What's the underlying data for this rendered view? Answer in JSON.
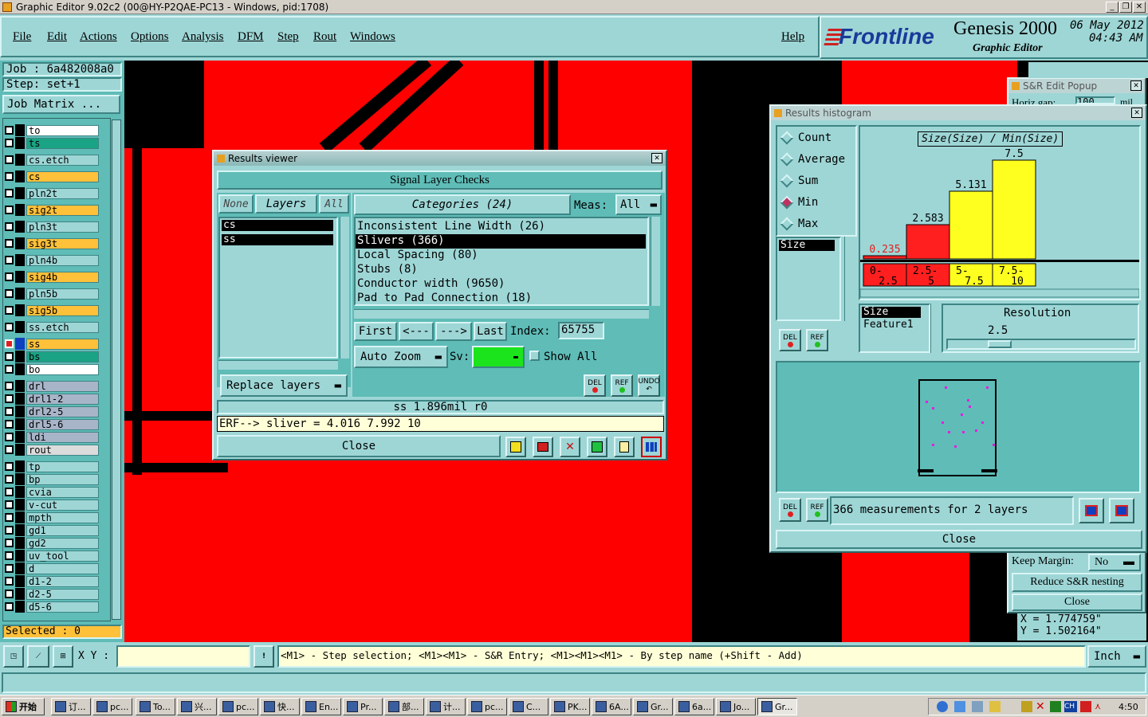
{
  "window_title": "Graphic Editor 9.02c2 (00@HY-P2QAE-PC13 - Windows, pid:1708)",
  "menu": {
    "file": "File",
    "edit": "Edit",
    "actions": "Actions",
    "options": "Options",
    "analysis": "Analysis",
    "dfm": "DFM",
    "step": "Step",
    "rout": "Rout",
    "windows": "Windows",
    "help": "Help"
  },
  "brand": {
    "logo": "Frontline",
    "product": "Genesis 2000",
    "subtitle": "Graphic Editor",
    "date": "06 May 2012",
    "time": "04:43 AM"
  },
  "left": {
    "job": "Job : 6a482008a0",
    "step": "Step: set+1",
    "job_matrix": "Job Matrix ...",
    "selected": "Selected : 0",
    "layers": [
      {
        "name": "to",
        "color": "#ffffff"
      },
      {
        "name": "ts",
        "color": "#1aa384"
      },
      {
        "name": "cs.etch",
        "color": "#9ed6d6"
      },
      {
        "name": "cs",
        "color": "#ffc03a"
      },
      {
        "name": "pln2t",
        "color": "#9ed6d6"
      },
      {
        "name": "sig2t",
        "color": "#ffc03a"
      },
      {
        "name": "pln3t",
        "color": "#9ed6d6"
      },
      {
        "name": "sig3t",
        "color": "#ffc03a"
      },
      {
        "name": "pln4b",
        "color": "#9ed6d6"
      },
      {
        "name": "sig4b",
        "color": "#ffc03a"
      },
      {
        "name": "pln5b",
        "color": "#9ed6d6"
      },
      {
        "name": "sig5b",
        "color": "#ffc03a"
      },
      {
        "name": "ss.etch",
        "color": "#9ed6d6"
      },
      {
        "name": "ss",
        "color": "#ffc03a"
      },
      {
        "name": "bs",
        "color": "#1aa384"
      },
      {
        "name": "bo",
        "color": "#ffffff"
      },
      {
        "name": "drl",
        "color": "#a8b4c8"
      },
      {
        "name": "drl1-2",
        "color": "#a8b4c8"
      },
      {
        "name": "drl2-5",
        "color": "#a8b4c8"
      },
      {
        "name": "drl5-6",
        "color": "#a8b4c8"
      },
      {
        "name": "ldi",
        "color": "#a8b4c8"
      },
      {
        "name": "rout",
        "color": "#dcdcdc"
      },
      {
        "name": "tp",
        "color": "#9ed6d6"
      },
      {
        "name": "bp",
        "color": "#9ed6d6"
      },
      {
        "name": "cvia",
        "color": "#9ed6d6"
      },
      {
        "name": "v-cut",
        "color": "#9ed6d6"
      },
      {
        "name": "mpth",
        "color": "#9ed6d6"
      },
      {
        "name": "gd1",
        "color": "#9ed6d6"
      },
      {
        "name": "gd2",
        "color": "#9ed6d6"
      },
      {
        "name": "uv_tool",
        "color": "#9ed6d6"
      },
      {
        "name": "d",
        "color": "#9ed6d6"
      },
      {
        "name": "d1-2",
        "color": "#9ed6d6"
      },
      {
        "name": "d2-5",
        "color": "#9ed6d6"
      },
      {
        "name": "d5-6",
        "color": "#9ed6d6"
      }
    ]
  },
  "results_viewer": {
    "title": "Results viewer",
    "header": "Signal Layer Checks",
    "none": "None",
    "layers": "Layers",
    "all": "All",
    "layer_list": [
      "cs",
      "ss"
    ],
    "categories": "Categories (24)",
    "meas_label": "Meas:",
    "meas_value": "All",
    "category_list": [
      "Inconsistent Line Width (26)",
      "Slivers (366)",
      "Local Spacing (80)",
      "Stubs (8)",
      "Conductor width (9650)",
      "Pad to Pad Connection (18)"
    ],
    "first": "First",
    "prev": "<---",
    "next": "--->",
    "last": "Last",
    "index_label": "Index:",
    "index_value": "65755",
    "auto_zoom": "Auto Zoom",
    "sv": "Sv:",
    "show_all": "Show All",
    "replace_layers": "Replace layers",
    "del": "DEL",
    "ref": "REF",
    "undo": "UNDO",
    "status": "ss 1.896mil r0",
    "erf": "ERF--> sliver = 4.016 7.992 10",
    "close": "Close"
  },
  "histogram": {
    "title": "Results histogram",
    "options": [
      "Count",
      "Average",
      "Sum",
      "Min",
      "Max"
    ],
    "selected_option": "Min",
    "list_item": "Size",
    "chart_title": "Size(Size) / Min(Size)",
    "bars": [
      {
        "range_top": "0-",
        "range_bottom": "2.5",
        "value": "0.235",
        "color": "#ff1f1f"
      },
      {
        "range_top": "2.5-",
        "range_bottom": "5",
        "value": "2.583",
        "color": "#ff1f1f"
      },
      {
        "range_top": "5-",
        "range_bottom": "7.5",
        "value": "5.131",
        "color": "#ffff1f"
      },
      {
        "range_top": "7.5-",
        "range_bottom": "10",
        "value": "7.5",
        "color": "#ffff1f"
      }
    ],
    "attr_list": [
      "Size",
      "Feature1"
    ],
    "resolution_label": "Resolution",
    "resolution_value": "2.5",
    "measurements": "366 measurements for 2 layers",
    "del": "DEL",
    "ref": "REF",
    "close": "Close"
  },
  "sr_popup": {
    "title": "S&R Edit Popup",
    "horiz_gap": "Horiz gap:",
    "horiz_value": "100",
    "unit": "mil",
    "keep_margin": "Keep Margin:",
    "keep_value": "No",
    "reduce": "Reduce S&R nesting",
    "close": "Close",
    "x": "X = 1.774759\"",
    "y": "Y = 1.502164\""
  },
  "status": {
    "xy_label": "X Y :",
    "hint": "<M1> - Step selection; <M1><M1> - S&R Entry; <M1><M1><M1> - By step name (+Shift - Add)",
    "unit": "Inch"
  },
  "taskbar": {
    "start": "开始",
    "tasks": [
      "订...",
      "pc...",
      "To...",
      "兴...",
      "pc...",
      "快...",
      "En...",
      "Pr...",
      "部...",
      "计...",
      "pc...",
      "C...",
      "PK...",
      "6A...",
      "Gr...",
      "6a...",
      "Jo...",
      "Gr..."
    ],
    "clock": "4:50"
  }
}
